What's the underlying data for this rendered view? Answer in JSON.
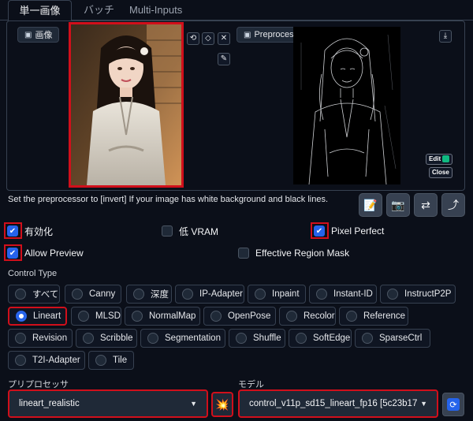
{
  "tabs": [
    {
      "label": "単一画像"
    },
    {
      "label": "バッチ"
    },
    {
      "label": "Multi-Inputs"
    }
  ],
  "input_panel": {
    "label": "画像"
  },
  "preview_panel": {
    "label": "Preprocessor Preview",
    "edit_label": "Edit",
    "close_label": "Close"
  },
  "tip": "Set the preprocessor to [invert] If your image has white background and black lines.",
  "options": {
    "enable": {
      "label": "有効化",
      "checked": true
    },
    "low_vram": {
      "label": "低 VRAM",
      "checked": false
    },
    "pixel_perfect": {
      "label": "Pixel Perfect",
      "checked": true
    },
    "allow_preview": {
      "label": "Allow Preview",
      "checked": true
    },
    "effective_region_mask": {
      "label": "Effective Region Mask",
      "checked": false
    }
  },
  "control_type": {
    "label": "Control Type",
    "selected": "Lineart",
    "items": [
      "すべて",
      "Canny",
      "深度",
      "IP-Adapter",
      "Inpaint",
      "Instant-ID",
      "InstructP2P",
      "Lineart",
      "MLSD",
      "NormalMap",
      "OpenPose",
      "Recolor",
      "Reference",
      "Revision",
      "Scribble",
      "Segmentation",
      "Shuffle",
      "SoftEdge",
      "SparseCtrl",
      "T2I-Adapter",
      "Tile"
    ]
  },
  "preprocessor": {
    "label": "プリプロセッサ",
    "value": "lineart_realistic"
  },
  "model": {
    "label": "モデル",
    "value": "control_v11p_sd15_lineart_fp16 [5c23b17"
  },
  "colors": {
    "accent": "#2563eb",
    "highlight": "#d10f1b",
    "background": "#0b0f19"
  }
}
